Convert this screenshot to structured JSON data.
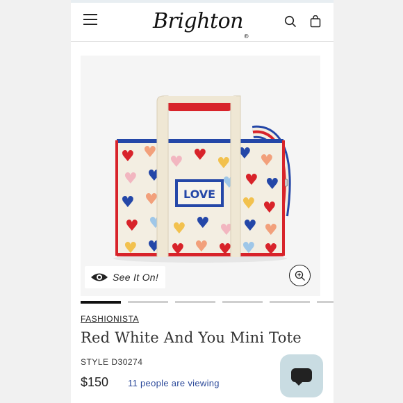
{
  "header": {
    "logo_text": "Brighton",
    "logo_reg": "®",
    "icons": [
      "menu-icon",
      "search-icon",
      "bag-icon"
    ]
  },
  "gallery": {
    "see_it_on_label": "See It On!",
    "icons": [
      "eye-icon",
      "zoom-icon"
    ],
    "slide_count": 6,
    "active_slide": 1,
    "image": {
      "love_patch_text": "LOVE",
      "colors": {
        "red": "#d8232a",
        "blue": "#2447a8",
        "cream": "#f3eee2"
      }
    }
  },
  "product": {
    "brand": "FASHIONISTA",
    "title": "Red White And You Mini Tote",
    "style": "STYLE D30274",
    "price": "$150",
    "viewers": "11 people are viewing"
  },
  "chat": {
    "icon": "chat-bubble-icon"
  },
  "colors": {
    "accent_blue": "#2c4a9a",
    "chat_bg": "#c9dce2"
  }
}
